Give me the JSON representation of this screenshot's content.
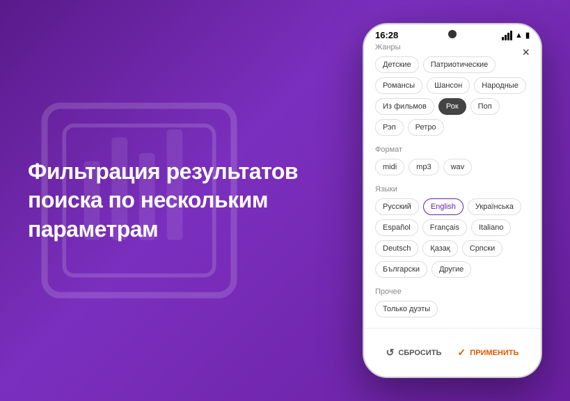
{
  "background": {
    "gradient_start": "#5a1a8a",
    "gradient_end": "#6a1fa0"
  },
  "left_text": {
    "heading": "Фильтрация результатов поиска по нескольким параметрам"
  },
  "phone": {
    "status_bar": {
      "time": "16:28",
      "notch_label": "camera-notch",
      "signal": "●●●",
      "wifi": "wifi",
      "battery": "battery"
    },
    "close_button": "×",
    "sections": [
      {
        "id": "genres",
        "label": "Жанры",
        "tags": [
          {
            "text": "Детские",
            "active": false
          },
          {
            "text": "Патриотические",
            "active": false
          },
          {
            "text": "Романсы",
            "active": false
          },
          {
            "text": "Шансон",
            "active": false
          },
          {
            "text": "Народные",
            "active": false
          },
          {
            "text": "Из фильмов",
            "active": false
          },
          {
            "text": "Рок",
            "active": true
          },
          {
            "text": "Поп",
            "active": false
          },
          {
            "text": "Рэп",
            "active": false
          },
          {
            "text": "Ретро",
            "active": false
          }
        ]
      },
      {
        "id": "format",
        "label": "Формат",
        "tags": [
          {
            "text": "midi",
            "active": false
          },
          {
            "text": "mp3",
            "active": false
          },
          {
            "text": "wav",
            "active": false
          }
        ]
      },
      {
        "id": "languages",
        "label": "Языки",
        "tags": [
          {
            "text": "Русский",
            "active": false
          },
          {
            "text": "English",
            "active": true,
            "style": "purple-border"
          },
          {
            "text": "Українська",
            "active": false
          },
          {
            "text": "Español",
            "active": false
          },
          {
            "text": "Français",
            "active": false
          },
          {
            "text": "Italiano",
            "active": false
          },
          {
            "text": "Deutsch",
            "active": false
          },
          {
            "text": "Қазақ",
            "active": false
          },
          {
            "text": "Српски",
            "active": false
          },
          {
            "text": "Български",
            "active": false
          },
          {
            "text": "Другие",
            "active": false
          }
        ]
      },
      {
        "id": "other",
        "label": "Прочее",
        "tags": [
          {
            "text": "Только дуэты",
            "active": false
          }
        ]
      }
    ],
    "bottom_bar": {
      "reset_label": "СБРОСИТЬ",
      "apply_label": "ПРИМЕНИТЬ",
      "reset_icon": "↺",
      "apply_icon": "✓"
    }
  }
}
